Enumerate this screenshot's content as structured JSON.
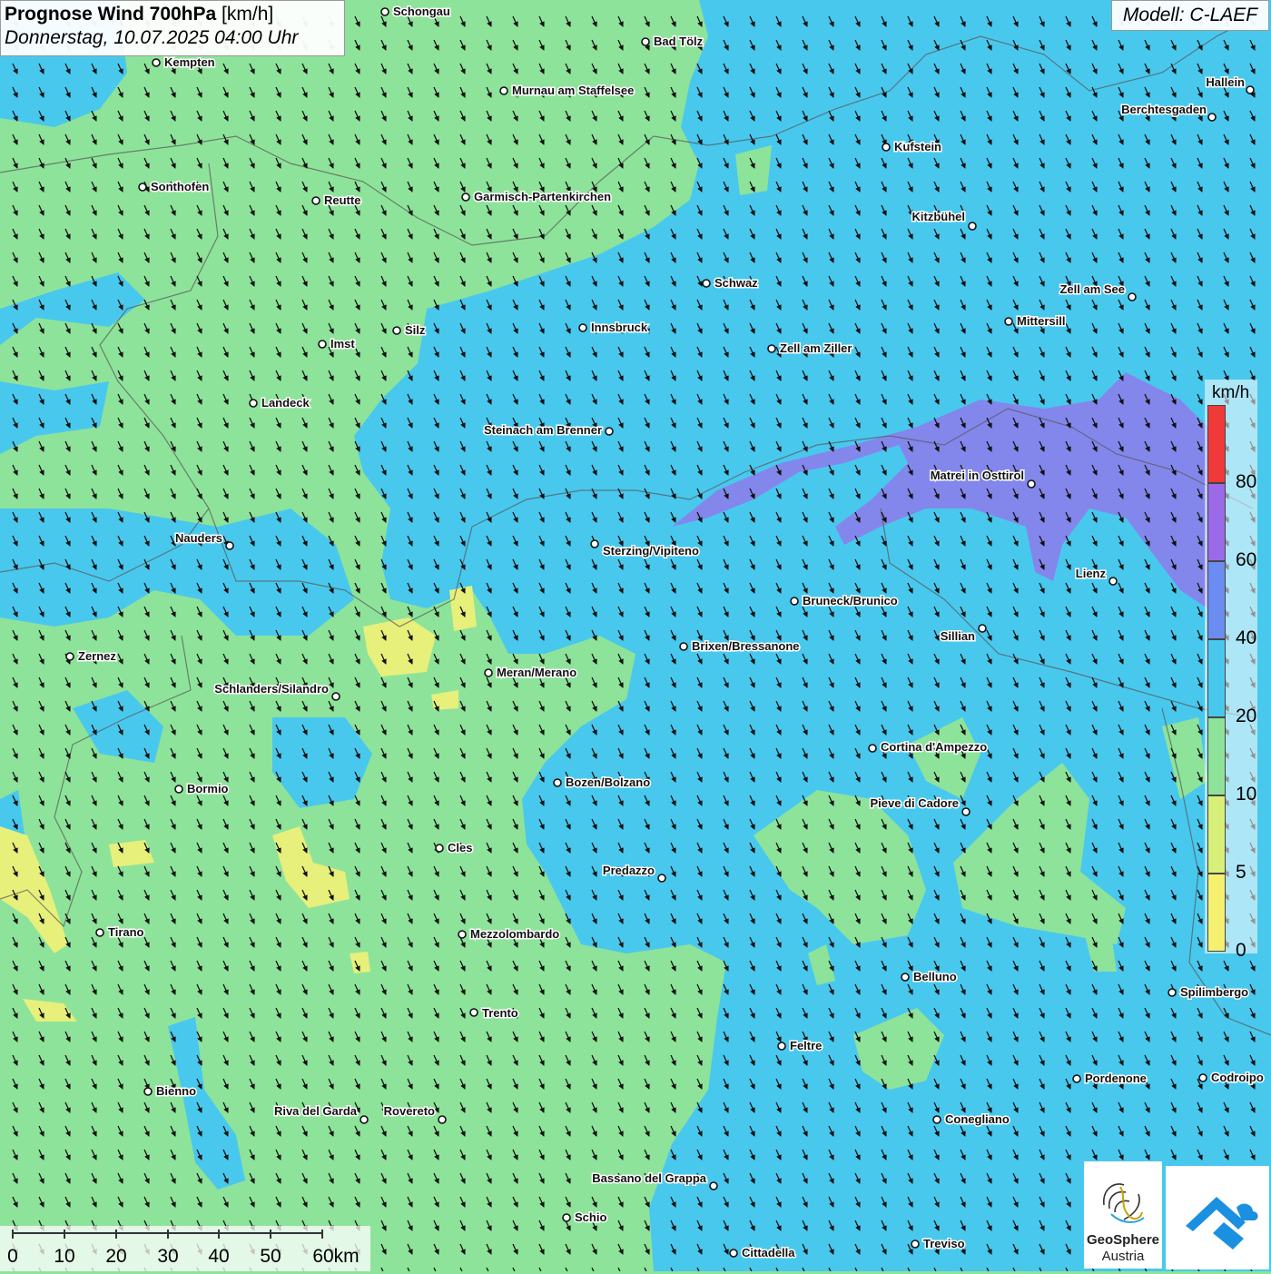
{
  "header": {
    "title_bold": "Prognose Wind 700hPa",
    "title_unit": "[km/h]",
    "datetime": "Donnerstag, 10.07.2025 04:00 Uhr",
    "model": "Modell: C-LAEF"
  },
  "legend": {
    "unit": "km/h",
    "ticks": [
      "80",
      "60",
      "40",
      "20",
      "10",
      "5",
      "0"
    ],
    "colors": {
      "0-5": "#f5f070",
      "5-10": "#d8f07a",
      "10-20": "#8ee39a",
      "20-40": "#49c8ee",
      "40-60": "#6b8cf0",
      "60-80": "#9a6ae8",
      "80+": "#f03a3a"
    }
  },
  "wind": {
    "direction": "from north-west (arrows pointing south-east)"
  },
  "cities": [
    {
      "name": "Schongau"
    },
    {
      "name": "Bad Tölz"
    },
    {
      "name": "Kempten"
    },
    {
      "name": "Murnau am Staffelsee"
    },
    {
      "name": "Hallein"
    },
    {
      "name": "Berchtesgaden"
    },
    {
      "name": "Kufstein"
    },
    {
      "name": "Sonthofen"
    },
    {
      "name": "Reutte"
    },
    {
      "name": "Garmisch-Partenkirchen"
    },
    {
      "name": "Kitzbühel"
    },
    {
      "name": "Schwaz"
    },
    {
      "name": "Zell am See"
    },
    {
      "name": "Innsbruck"
    },
    {
      "name": "Mittersill"
    },
    {
      "name": "Imst"
    },
    {
      "name": "Silz"
    },
    {
      "name": "Zell am Ziller"
    },
    {
      "name": "Landeck"
    },
    {
      "name": "Steinach am Brenner"
    },
    {
      "name": "Matrei in Osttirol"
    },
    {
      "name": "Nauders"
    },
    {
      "name": "Sterzing/Vipiteno"
    },
    {
      "name": "Lienz"
    },
    {
      "name": "Bruneck/Brunico"
    },
    {
      "name": "Sillian"
    },
    {
      "name": "Zernez"
    },
    {
      "name": "Brixen/Bressanone"
    },
    {
      "name": "Meran/Merano"
    },
    {
      "name": "Schlanders/Silandro"
    },
    {
      "name": "Cortina d'Ampezzo"
    },
    {
      "name": "Bozen/Bolzano"
    },
    {
      "name": "Bormio"
    },
    {
      "name": "Pieve di Cadore"
    },
    {
      "name": "Cles"
    },
    {
      "name": "Predazzo"
    },
    {
      "name": "Tirano"
    },
    {
      "name": "Mezzolombardo"
    },
    {
      "name": "Belluno"
    },
    {
      "name": "Spilimbergo"
    },
    {
      "name": "Trento"
    },
    {
      "name": "Feltre"
    },
    {
      "name": "Bienno"
    },
    {
      "name": "Pordenone"
    },
    {
      "name": "Codroipo"
    },
    {
      "name": "Riva del Garda"
    },
    {
      "name": "Rovereto"
    },
    {
      "name": "Conegliano"
    },
    {
      "name": "Bassano del Grappa"
    },
    {
      "name": "Schio"
    },
    {
      "name": "Treviso"
    },
    {
      "name": "Cittadella"
    }
  ],
  "scale_bar": {
    "labels": [
      "0",
      "10",
      "20",
      "30",
      "40",
      "50",
      "60km"
    ]
  },
  "logos": {
    "geosphere_line1": "GeoSphere",
    "geosphere_line2": "Austria"
  }
}
